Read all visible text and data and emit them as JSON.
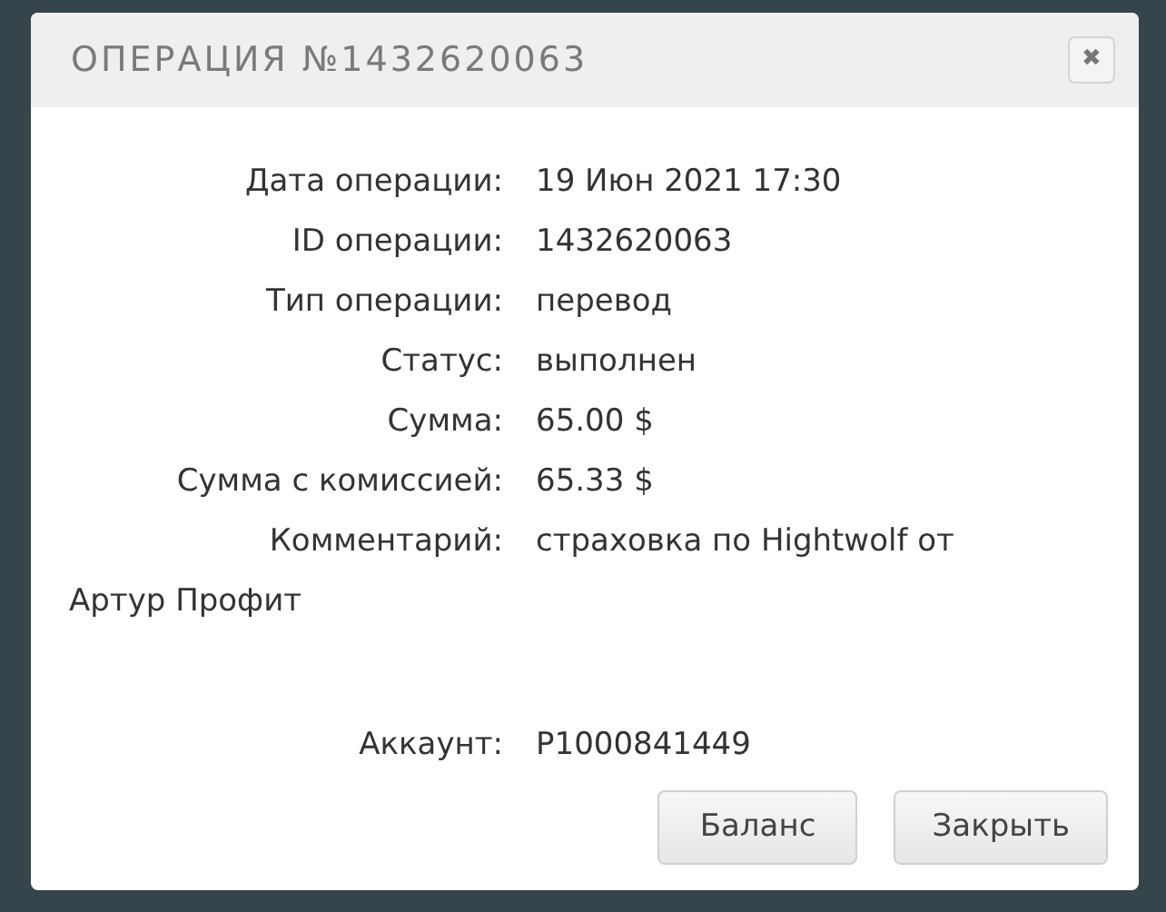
{
  "dialog": {
    "title": "ОПЕРАЦИЯ №1432620063",
    "close_icon": "✖"
  },
  "fields": [
    {
      "label": "Дата операции:",
      "value": "19 Июн 2021 17:30"
    },
    {
      "label": "ID операции:",
      "value": "1432620063"
    },
    {
      "label": "Тип операции:",
      "value": "перевод"
    },
    {
      "label": "Статус:",
      "value": "выполнен"
    },
    {
      "label": "Сумма:",
      "value": "65.00 $"
    },
    {
      "label": "Сумма с комиссией:",
      "value": "65.33 $"
    },
    {
      "label": "Комментарий:",
      "value": "страховка по Hightwolf от",
      "continuation": "Артур Профит"
    },
    {
      "label": "Аккаунт:",
      "value": "P1000841449"
    }
  ],
  "buttons": [
    "Баланс",
    "Закрыть"
  ]
}
